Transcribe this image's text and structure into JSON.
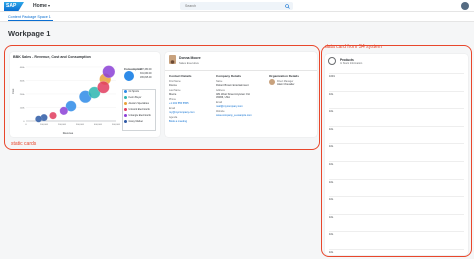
{
  "shell": {
    "logo_text": "SAP",
    "home_label": "Home",
    "home_caret": "▾",
    "search_placeholder": "Search"
  },
  "tab": {
    "label": "Content Package Space 1"
  },
  "page": {
    "title": "Workpage 1"
  },
  "annotations": {
    "static_label": "static cards",
    "data_label": "data card from S4 system"
  },
  "chart_card": {
    "title": "BBK Sales - Revenue, Cost and Consumption",
    "legend_title": "Consumption",
    "bubble_sizes": [
      "497,450.00",
      "331,630.00",
      "165,815.00"
    ],
    "legend_items": [
      {
        "label": "Ck Sports",
        "color": "#2e8be8"
      },
      {
        "label": "Kevin Buyer",
        "color": "#2cb6b0"
      },
      {
        "label": "Alexia's Specialties",
        "color": "#e8a13a"
      },
      {
        "label": "Uniwork Electrical E",
        "color": "#e03c5e"
      },
      {
        "label": "Untangle Electrical E",
        "color": "#8b3fd6"
      },
      {
        "label": "Gravy Market",
        "color": "#2e5aa6"
      }
    ]
  },
  "chart_data": {
    "type": "scatter",
    "title": "BBK Sales - Revenue, Cost and Consumption",
    "xlabel": "Revenue",
    "ylabel": "Cost",
    "x_ticks": [
      "0",
      "100,000",
      "200,000",
      "300,000",
      "400,000",
      "500,000"
    ],
    "y_ticks": [
      "0",
      "100k",
      "200k",
      "300k",
      "400k"
    ],
    "xlim": [
      0,
      500000
    ],
    "ylim": [
      0,
      400000
    ],
    "series": [
      {
        "name": "Ck Sports",
        "color": "#2e8be8",
        "points": [
          [
            330000,
            180000,
            300000
          ],
          [
            250000,
            110000,
            200000
          ]
        ]
      },
      {
        "name": "Kevin Buyer",
        "color": "#2cb6b0",
        "points": [
          [
            380000,
            210000,
            260000
          ]
        ]
      },
      {
        "name": "Alexia's Specialties",
        "color": "#e8a13a",
        "points": [
          [
            440000,
            310000,
            240000
          ]
        ]
      },
      {
        "name": "Uniwork Electrical E",
        "color": "#e03c5e",
        "points": [
          [
            430000,
            250000,
            280000
          ],
          [
            150000,
            40000,
            60000
          ]
        ]
      },
      {
        "name": "Untangle Electrical E",
        "color": "#8b3fd6",
        "points": [
          [
            460000,
            365000,
            300000
          ],
          [
            210000,
            75000,
            90000
          ]
        ]
      },
      {
        "name": "Gravy Market",
        "color": "#2e5aa6",
        "points": [
          [
            100000,
            25000,
            55000
          ],
          [
            70000,
            15000,
            45000
          ]
        ]
      }
    ]
  },
  "contact_card": {
    "name": "Donna Moore",
    "role": "Sales Executive",
    "columns": [
      {
        "heading": "Contact Details",
        "fields": [
          {
            "label": "First Name",
            "value": "Donna",
            "link": false
          },
          {
            "label": "Last Name",
            "value": "Moore",
            "link": false
          },
          {
            "label": "Phone",
            "value": "+1 202 555 5555",
            "link": true
          },
          {
            "label": "Email",
            "value": "my@mycompany.com",
            "link": true
          },
          {
            "label": "Agenda",
            "value": "Book a meeting",
            "link": true
          }
        ]
      },
      {
        "heading": "Company Details",
        "fields": [
          {
            "label": "Name",
            "value": "Robert Brown Entertainment",
            "link": false
          },
          {
            "label": "Address",
            "value": "481 West Street Anytown OH 45066, USA",
            "link": false
          },
          {
            "label": "Email",
            "value": "mail@mycompany.com",
            "link": true
          },
          {
            "label": "Website",
            "value": "www.company_a.example.com",
            "link": true
          }
        ]
      },
      {
        "heading": "Organization Details",
        "fields": [
          {
            "label": "Direct Manager",
            "value": "Alain Chevalier",
            "link": false
          }
        ]
      }
    ]
  },
  "list_card": {
    "title": "Products",
    "subtitle": "In Stock Information",
    "rows": [
      "1001",
      "10L",
      "10L",
      "10L",
      "10L",
      "10L",
      "10L",
      "10L",
      "10L",
      "10L",
      "10L"
    ]
  }
}
